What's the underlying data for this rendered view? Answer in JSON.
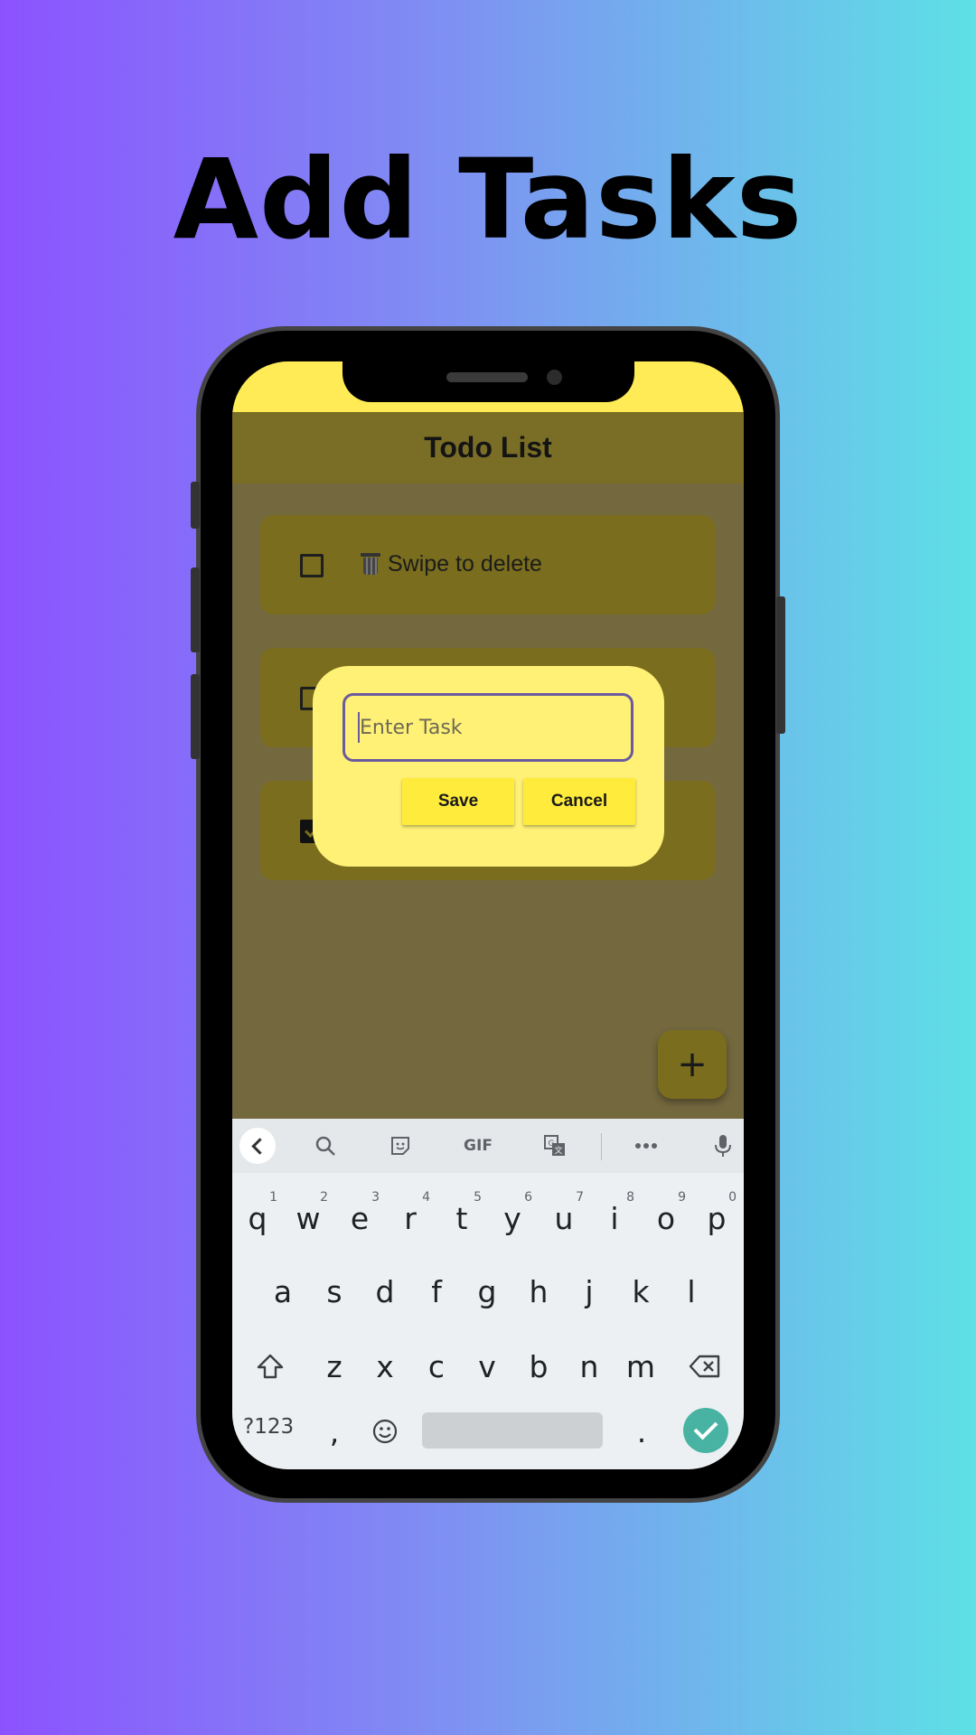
{
  "headline": "Add Tasks",
  "app": {
    "title": "Todo List",
    "tasks": [
      {
        "label": "Swipe to delete",
        "checked": false
      },
      {
        "label": "",
        "checked": false
      },
      {
        "label": "",
        "checked": true
      }
    ],
    "fab_label": "+"
  },
  "dialog": {
    "placeholder": "Enter Task",
    "value": "",
    "save_label": "Save",
    "cancel_label": "Cancel"
  },
  "keyboard": {
    "toolbar_icons": [
      "back-icon",
      "search-icon",
      "sticker-icon",
      "gif-icon",
      "translate-icon",
      "more-icon",
      "mic-icon"
    ],
    "gif_label": "GIF",
    "row1": [
      "q",
      "w",
      "e",
      "r",
      "t",
      "y",
      "u",
      "i",
      "o",
      "p"
    ],
    "row1_hints": [
      "1",
      "2",
      "3",
      "4",
      "5",
      "6",
      "7",
      "8",
      "9",
      "0"
    ],
    "row2": [
      "a",
      "s",
      "d",
      "f",
      "g",
      "h",
      "j",
      "k",
      "l"
    ],
    "row3": [
      "z",
      "x",
      "c",
      "v",
      "b",
      "n",
      "m"
    ],
    "symbols_label": "?123",
    "comma": ",",
    "period": "."
  },
  "colors": {
    "accent": "#ffeb3b",
    "dialog_bg": "#fff176",
    "input_border": "#6a5aa0",
    "done_key": "#48b3a2"
  }
}
